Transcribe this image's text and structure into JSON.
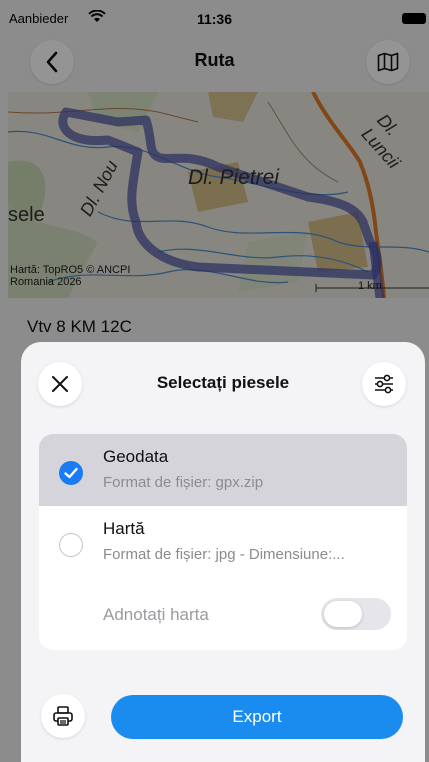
{
  "status_bar": {
    "carrier": "Aanbieder",
    "time": "11:36"
  },
  "nav": {
    "title": "Ruta"
  },
  "map": {
    "labels": [
      "Dl. Pietrei",
      "Dl. Nou",
      "Dl. Luncii",
      "sele"
    ],
    "credit_line1": "Hartă: TopRO5 © ANCPI",
    "credit_line2": "Romania 2026",
    "scale": "1 km"
  },
  "route": {
    "name": "Vtv 8 KM 12C"
  },
  "sheet": {
    "title": "Selectați piesele",
    "options": [
      {
        "title": "Geodata",
        "subtitle": "Format de fișier: gpx.zip",
        "selected": true
      },
      {
        "title": "Hartă",
        "subtitle": "Format de fișier: jpg - Dimensiune:...",
        "selected": false
      }
    ],
    "annotate": {
      "label": "Adnotați harta",
      "enabled": false
    },
    "export_label": "Export"
  },
  "colors": {
    "accent": "#1a8cf0",
    "route": "#4b52a8",
    "road": "#e07a2a"
  }
}
